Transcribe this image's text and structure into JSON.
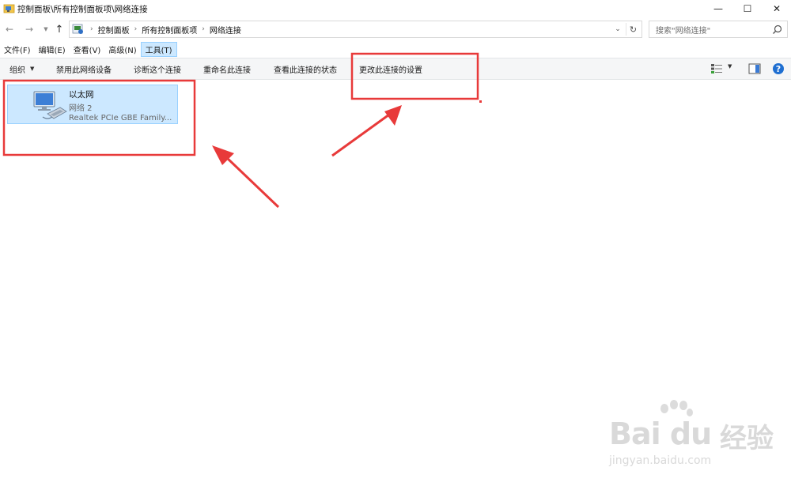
{
  "window": {
    "title": "控制面板\\所有控制面板项\\网络连接",
    "controls": {
      "minimize": "—",
      "maximize": "☐",
      "close": "✕"
    }
  },
  "address": {
    "crumbs": [
      "控制面板",
      "所有控制面板项",
      "网络连接"
    ],
    "search_placeholder": "搜索\"网络连接\""
  },
  "menu": {
    "items": [
      "文件(F)",
      "编辑(E)",
      "查看(V)",
      "高级(N)",
      "工具(T)"
    ],
    "active": "工具(T)"
  },
  "commands": {
    "organize": "组织",
    "disable": "禁用此网络设备",
    "diagnose": "诊断这个连接",
    "rename": "重命名此连接",
    "view_status": "查看此连接的状态",
    "change_settings": "更改此连接的设置"
  },
  "connection": {
    "name": "以太网",
    "network": "网络  2",
    "adapter": "Realtek PCIe GBE Family..."
  },
  "annotation_color": "#e83a3a",
  "watermark": {
    "logo": "Bai du",
    "brand": "经验",
    "url": "jingyan.baidu.com"
  }
}
